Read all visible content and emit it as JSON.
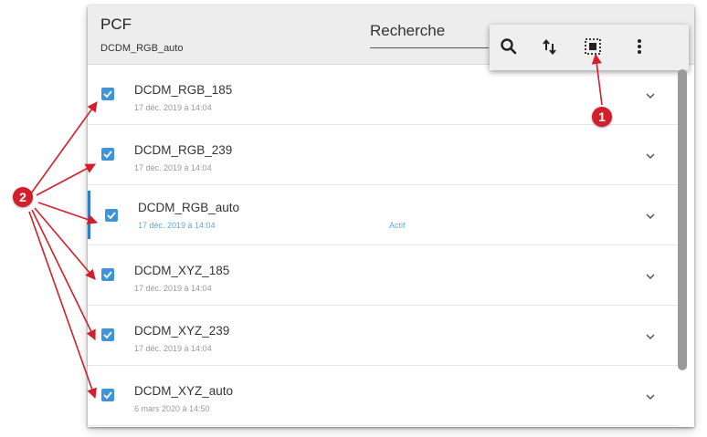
{
  "header": {
    "title": "PCF",
    "subtitle": "DCDM_RGB_auto",
    "search_placeholder": "Recherche"
  },
  "toolbar": {
    "icons": [
      "search-icon",
      "sort-icon",
      "select-all-icon",
      "more-vert-icon"
    ]
  },
  "items": [
    {
      "name": "DCDM_RGB_185",
      "date": "17 déc. 2019 à 14:04",
      "status": "",
      "checked": true
    },
    {
      "name": "DCDM_RGB_239",
      "date": "17 déc. 2019 à 14:04",
      "status": "",
      "checked": true
    },
    {
      "name": "DCDM_RGB_auto",
      "date": "17 déc. 2019 à 14:04",
      "status": "Actif",
      "checked": true
    },
    {
      "name": "DCDM_XYZ_185",
      "date": "17 déc. 2019 à 14:04",
      "status": "",
      "checked": true
    },
    {
      "name": "DCDM_XYZ_239",
      "date": "17 déc. 2019 à 14:04",
      "status": "",
      "checked": true
    },
    {
      "name": "DCDM_XYZ_auto",
      "date": "6 mars 2020 à 14:50",
      "status": "",
      "checked": true
    }
  ],
  "annotations": {
    "callout_1": "1",
    "callout_2": "2",
    "color": "#d11f2b"
  },
  "colors": {
    "accent": "#3f93d9",
    "active_text": "#5aa9e6",
    "header_bg": "#ededed"
  }
}
